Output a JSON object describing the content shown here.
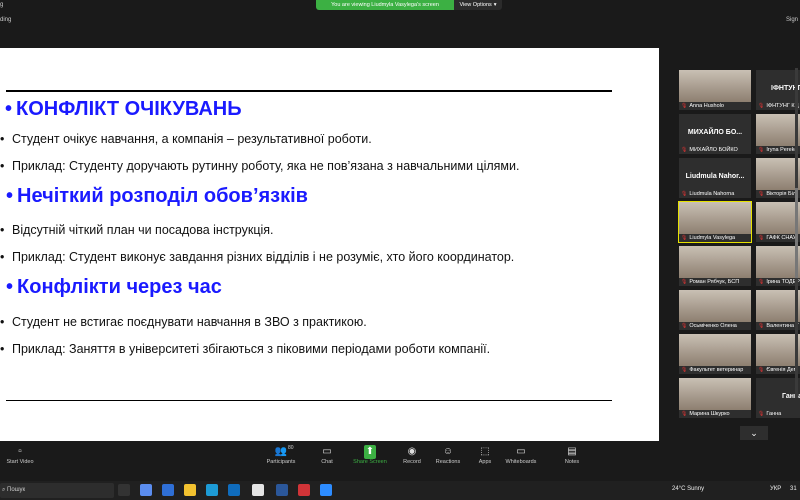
{
  "top": {
    "rec_label": "g",
    "rec2_label": "ding",
    "sign_label": "Sign",
    "share_banner": "You are viewing Liudmyla Vasylega's screen",
    "view_options": "View Options"
  },
  "slide": {
    "sections": [
      {
        "heading": "КОНФЛІКТ ОЧІКУВАНЬ",
        "bullets": [
          "Студент очікує навчання, а компанія – результативної роботи.",
          "Приклад: Студенту доручають рутинну роботу, яка не пов’язана з навчальними цілями."
        ]
      },
      {
        "heading": "Нечіткий розподіл обов’язків",
        "bullets": [
          "Відсутній чіткий план чи посадова інструкція.",
          "Приклад: Студент виконує завдання різних відділів і не розуміє, хто його координатор."
        ]
      },
      {
        "heading": "Конфлікти через час",
        "bullets": [
          "Студент не встигає поєднувати навчання в ЗВО з практикою.",
          "Приклад: Заняття в університеті збігаються з піковими періодами роботи компанії."
        ]
      }
    ]
  },
  "participants": [
    {
      "name": "Anna Husholo",
      "big": ""
    },
    {
      "name": "ІФНТУНГ КЦ",
      "big": "ІФНТУНГ КЦ"
    },
    {
      "name": "МИХАЙЛО БОЙКО",
      "big": "МИХАЙЛО БО..."
    },
    {
      "name": "Iryna Pereko",
      "big": ""
    },
    {
      "name": "Liudmula Nahorna",
      "big": "Liudmula Nahor..."
    },
    {
      "name": "Вікторія Біл",
      "big": ""
    },
    {
      "name": "Liudmyla Vasylega",
      "big": ""
    },
    {
      "name": "ГАФК СНАУ",
      "big": ""
    },
    {
      "name": "Роман Рябчук, БСП",
      "big": ""
    },
    {
      "name": "Ірина ТОДЕР",
      "big": ""
    },
    {
      "name": "Осьміченко Олена",
      "big": ""
    },
    {
      "name": "Валентина Т",
      "big": ""
    },
    {
      "name": "Факультет ветеринар",
      "big": ""
    },
    {
      "name": "Євгенія Дем",
      "big": ""
    },
    {
      "name": "Марина Шкурко",
      "big": ""
    },
    {
      "name": "Ганна",
      "big": "Ганна"
    }
  ],
  "toolbar": {
    "items": [
      {
        "label": "Start Video",
        "icon": "video-off-icon"
      },
      {
        "label": "Participants",
        "icon": "participants-icon",
        "count": "80"
      },
      {
        "label": "Chat",
        "icon": "chat-icon"
      },
      {
        "label": "Share Screen",
        "icon": "share-screen-icon"
      },
      {
        "label": "Record",
        "icon": "record-icon"
      },
      {
        "label": "Reactions",
        "icon": "reactions-icon"
      },
      {
        "label": "Apps",
        "icon": "apps-icon"
      },
      {
        "label": "Whiteboards",
        "icon": "whiteboard-icon"
      },
      {
        "label": "Notes",
        "icon": "notes-icon"
      }
    ]
  },
  "taskbar": {
    "search": "Пошук",
    "weather": "24°C  Sunny",
    "lang": "УКР",
    "clock": "31"
  },
  "colors": {
    "heading": "#1a1aff",
    "share_green": "#3cb043",
    "active_border": "#e6e200"
  }
}
